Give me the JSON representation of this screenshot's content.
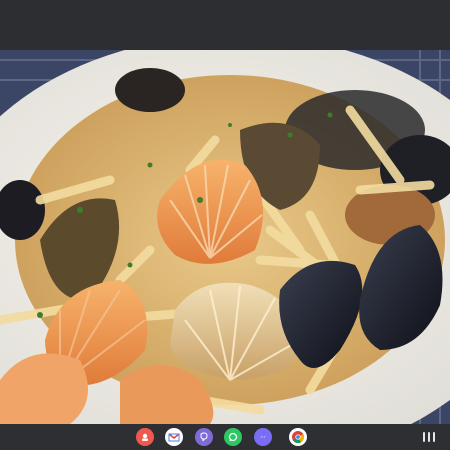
{
  "photo": {
    "subject": "food-photo",
    "alt": ""
  },
  "taskbar": {
    "apps": [
      {
        "icon": "camera-app-icon",
        "color": "#f0584f"
      },
      {
        "icon": "gmail-icon",
        "color": "#ffffff"
      },
      {
        "icon": "viber-icon",
        "color": "#7f6bd6"
      },
      {
        "icon": "whatsapp-icon",
        "color": "#2ec862"
      },
      {
        "icon": "messenger-icon",
        "color": "#7b6cf6"
      },
      {
        "icon": "chrome-icon",
        "color": "#ffffff"
      }
    ],
    "recents_icon": "recent-apps-icon"
  },
  "colors": {
    "top_bar": "#2c2e32",
    "taskbar": "#2d2f33"
  }
}
